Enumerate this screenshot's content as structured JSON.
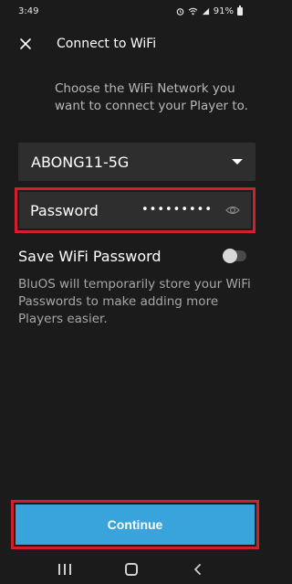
{
  "status_bar": {
    "time": "3:49",
    "battery": "91%"
  },
  "header": {
    "title": "Connect to WiFi"
  },
  "subtitle": "Choose the WiFi Network you want to connect your Player to.",
  "network": {
    "selected": "ABONG11-5G"
  },
  "password": {
    "label": "Password",
    "masked_value": "•••••••••"
  },
  "save_wifi": {
    "label": "Save WiFi Password",
    "enabled": false,
    "description": "BluOS will temporarily store your WiFi Passwords to make adding more Players easier."
  },
  "continue_label": "Continue",
  "colors": {
    "accent": "#39a3dc",
    "highlight": "#d0202e",
    "background": "#1b1b1b",
    "field": "#2e2e2e"
  }
}
